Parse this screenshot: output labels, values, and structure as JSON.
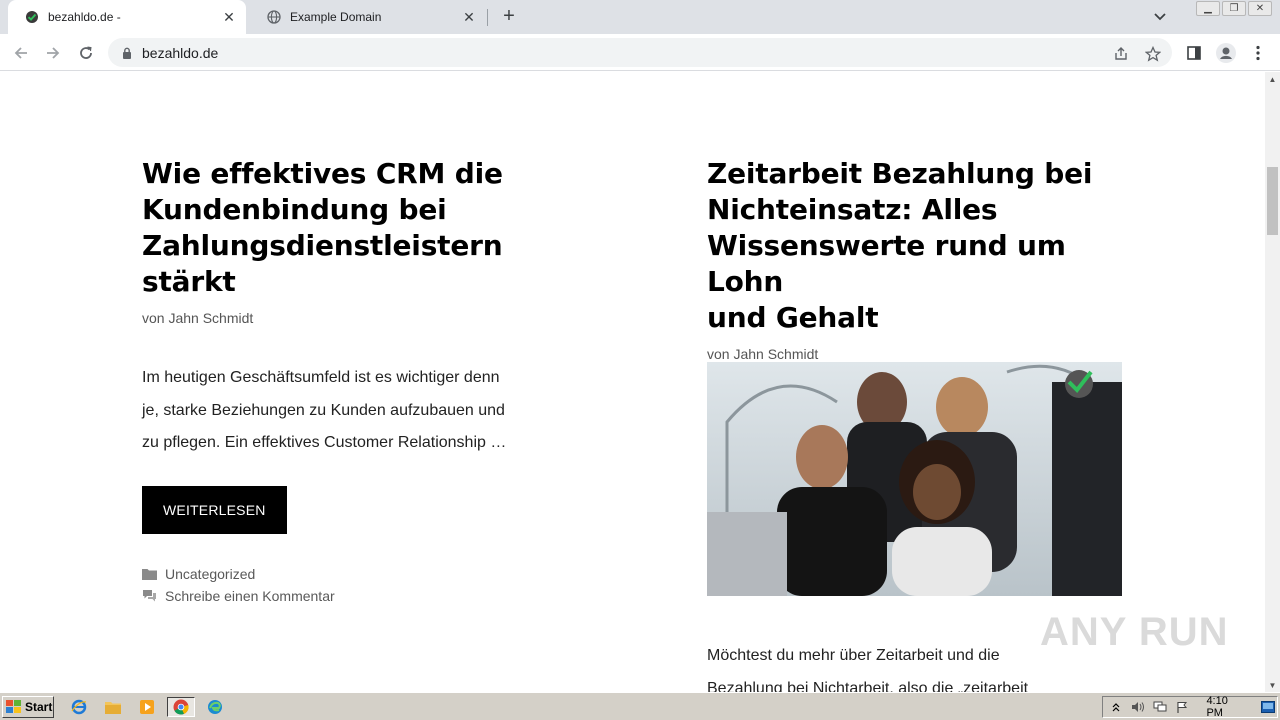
{
  "browser": {
    "tabs": [
      {
        "title": "bezahldo.de -",
        "active": true
      },
      {
        "title": "Example Domain",
        "active": false
      }
    ],
    "url": "bezahldo.de"
  },
  "posts": [
    {
      "title": "Wie effektives CRM die Kundenbindung bei Zahlungsdienstleistern stärkt",
      "title_lines": [
        "Wie effektives CRM die",
        "Kundenbindung bei",
        "Zahlungsdienstleistern",
        "stärkt"
      ],
      "byline_prefix": "von",
      "author": "Jahn Schmidt",
      "excerpt_lines": [
        "Im heutigen Geschäftsumfeld ist es wichtiger denn",
        "je, starke Beziehungen zu Kunden aufzubauen und",
        "zu pflegen. Ein effektives Customer Relationship …"
      ],
      "read_more": "WEITERLESEN",
      "category": "Uncategorized",
      "comment_link": "Schreibe einen Kommentar"
    },
    {
      "title": "Zeitarbeit Bezahlung bei Nichteinsatz: Alles Wissenswerte rund um Lohn und Gehalt",
      "title_lines": [
        "Zeitarbeit Bezahlung bei",
        "Nichteinsatz: Alles",
        "Wissenswerte rund um Lohn",
        "und Gehalt"
      ],
      "byline_prefix": "von",
      "author": "Jahn Schmidt",
      "excerpt_lines": [
        "Möchtest du mehr über Zeitarbeit und die",
        "Bezahlung bei Nichtarbeit, also die „zeitarbeit"
      ]
    }
  ],
  "watermark": "ANY RUN",
  "taskbar": {
    "start_label": "Start",
    "clock": "4:10 PM"
  }
}
